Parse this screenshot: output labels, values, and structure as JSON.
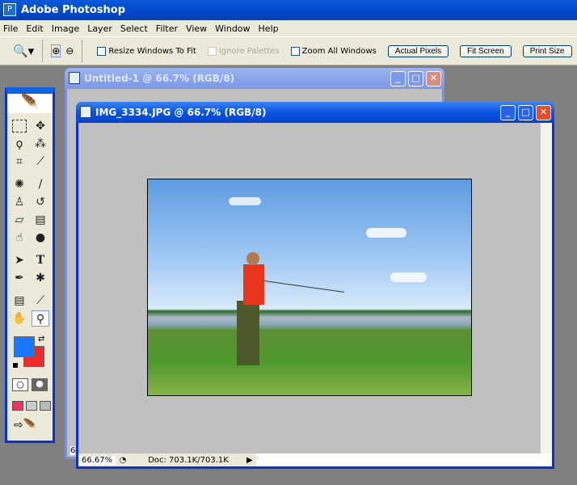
{
  "app": {
    "title": "Adobe Photoshop"
  },
  "menu": [
    "File",
    "Edit",
    "Image",
    "Layer",
    "Select",
    "Filter",
    "View",
    "Window",
    "Help"
  ],
  "options": {
    "resize_windows": "Resize Windows To Fit",
    "ignore_palettes": "Ignore Palettes",
    "zoom_all": "Zoom All Windows",
    "actual_pixels": "Actual Pixels",
    "fit_screen": "Fit Screen",
    "print_size": "Print Size"
  },
  "windows": {
    "back": {
      "title": "Untitled-1 @ 66.7% (RGB/8)",
      "zoom": "6"
    },
    "front": {
      "title": "IMG_3334.JPG @ 66.7% (RGB/8)",
      "zoom": "66.67%",
      "doc": "Doc: 703.1K/703.1K"
    }
  },
  "colors": {
    "foreground": "#1a78ff",
    "background": "#ee2b2b",
    "titlebar": "#0a54e3"
  },
  "tools": [
    "marquee",
    "move",
    "lasso",
    "magic-wand",
    "crop",
    "slice",
    "healing-brush",
    "brush",
    "clone-stamp",
    "history-brush",
    "eraser",
    "gradient",
    "blur",
    "dodge",
    "path-selection",
    "type",
    "pen",
    "custom-shape",
    "notes",
    "eyedropper",
    "hand",
    "zoom"
  ]
}
